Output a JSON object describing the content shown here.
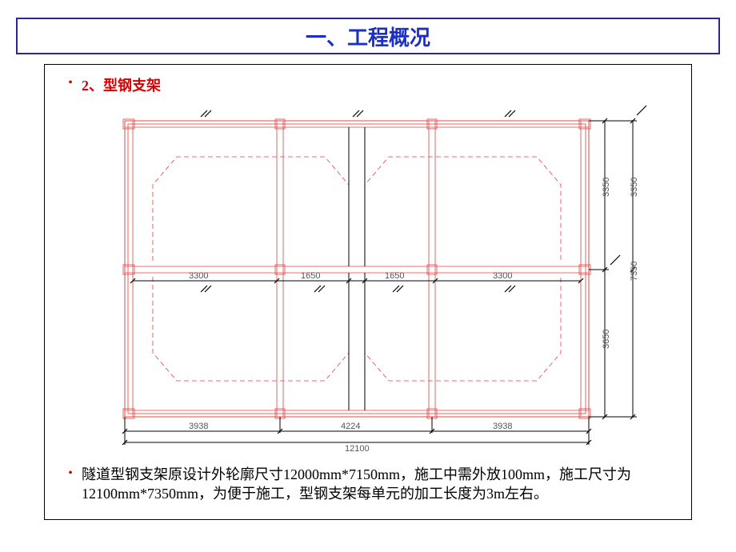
{
  "title": "一、工程概况",
  "subtitle": "2、型钢支架",
  "body": "隧道型钢支架原设计外轮廓尺寸12000mm*7150mm，施工中需外放100mm，施工尺寸为12100mm*7350mm，为便于施工，型钢支架每单元的加工长度为3m左右。",
  "diagram": {
    "bottom_dims": {
      "left": "3938",
      "mid": "4224",
      "right": "3938",
      "total": "12100"
    },
    "mid_dims": {
      "a": "3300",
      "b": "1650",
      "c": "1650",
      "d": "3300"
    },
    "right_dims_top": "3350",
    "right_dims_bottom": "3650",
    "far_right_top": "3350",
    "far_right_total": "7350"
  }
}
